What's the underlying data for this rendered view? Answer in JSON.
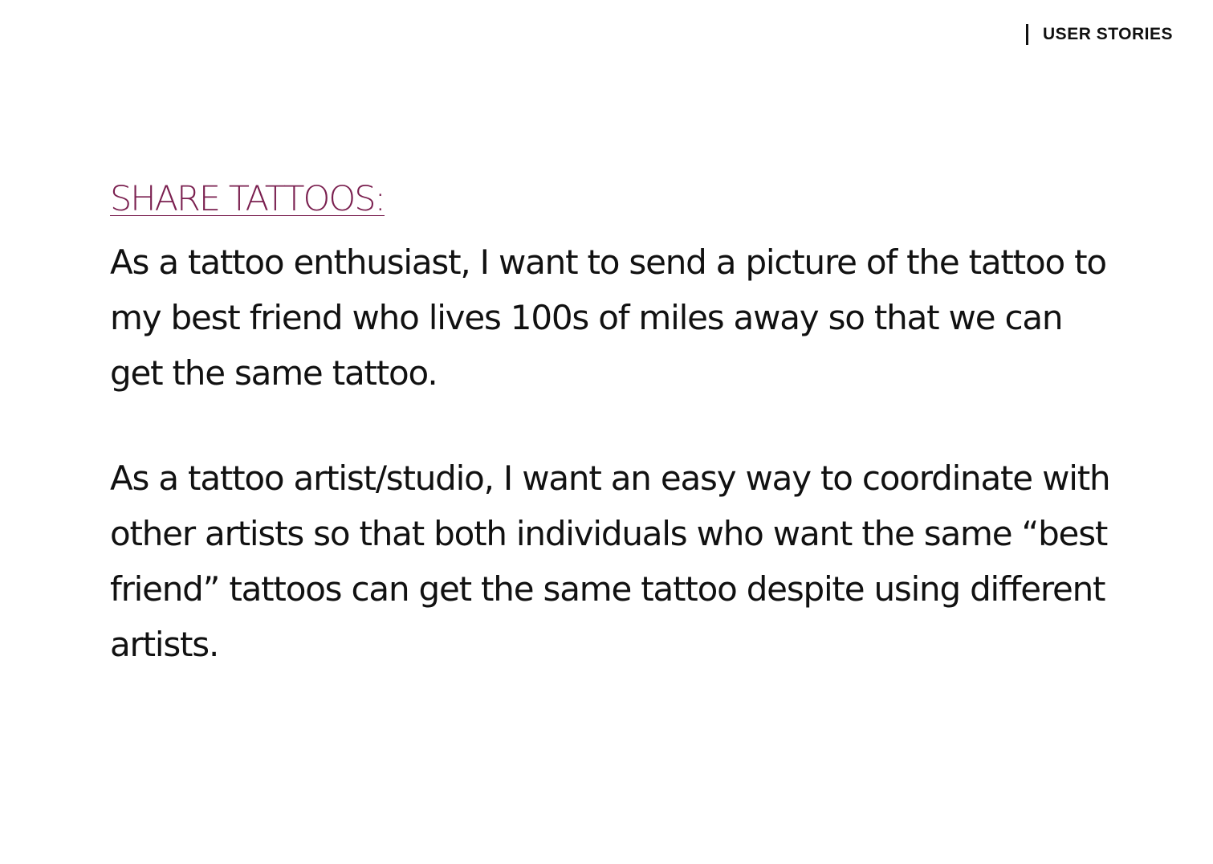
{
  "header": {
    "section_label": "USER STORIES"
  },
  "story": {
    "heading": "SHARE TATTOOS:",
    "paragraphs": [
      "As a tattoo enthusiast, I want to send a picture of the tattoo to my best friend who lives 100s of miles away so that we can get the same tattoo.",
      "As a tattoo artist/studio, I want an easy way to coordinate with other artists so that both individuals who want the same “best friend” tattoos can get the same tattoo despite using different artists."
    ]
  },
  "colors": {
    "heading": "#7a1f4f",
    "text": "#111111",
    "background": "#ffffff"
  }
}
